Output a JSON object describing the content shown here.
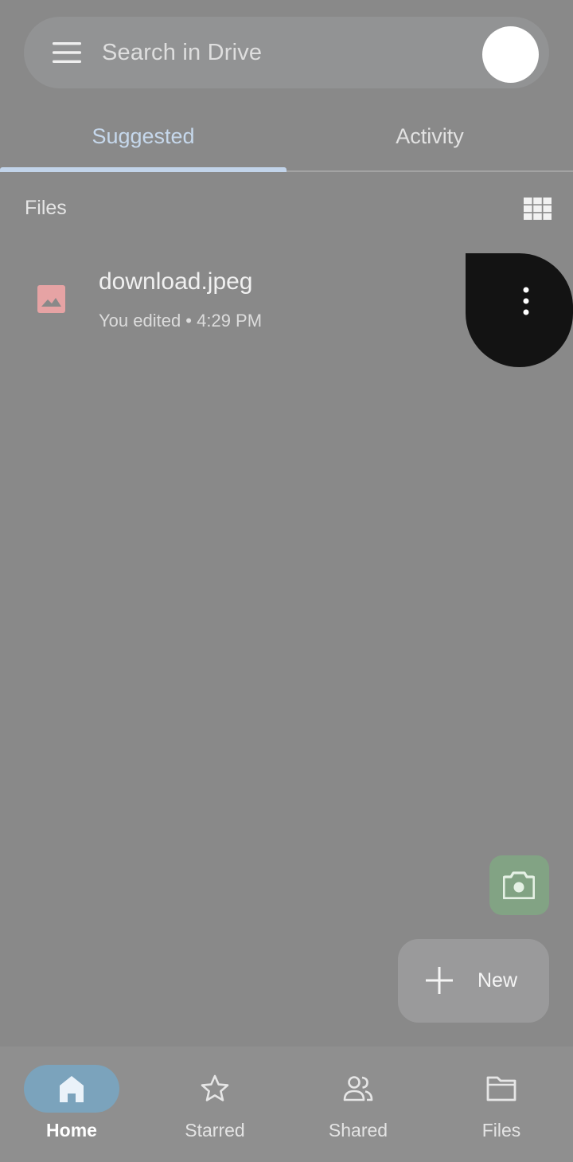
{
  "search": {
    "placeholder": "Search in Drive",
    "menu_icon": "hamburger-menu-icon",
    "avatar": "account-avatar"
  },
  "tabs": [
    {
      "label": "Suggested",
      "selected": true
    },
    {
      "label": "Activity",
      "selected": false
    }
  ],
  "files_section": {
    "heading": "Files",
    "view_toggle_icon": "grid-view-icon"
  },
  "files": [
    {
      "name": "download.jpeg",
      "meta": "You edited • 4:29 PM",
      "type_icon": "image-file-icon",
      "more_icon": "more-vert-icon"
    }
  ],
  "fabs": {
    "camera_icon": "camera-icon",
    "new_label": "New",
    "new_icon": "plus-icon"
  },
  "bottom_nav": [
    {
      "label": "Home",
      "icon": "home-icon",
      "active": true
    },
    {
      "label": "Starred",
      "icon": "star-icon",
      "active": false
    },
    {
      "label": "Shared",
      "icon": "people-icon",
      "active": false
    },
    {
      "label": "Files",
      "icon": "folder-icon",
      "active": false
    }
  ],
  "colors": {
    "background": "#898989",
    "tab_accent": "#c2d4ea",
    "home_pill": "#7ba3bc",
    "camera_fab": "#82a384",
    "image_icon": "#e6a3a4"
  }
}
